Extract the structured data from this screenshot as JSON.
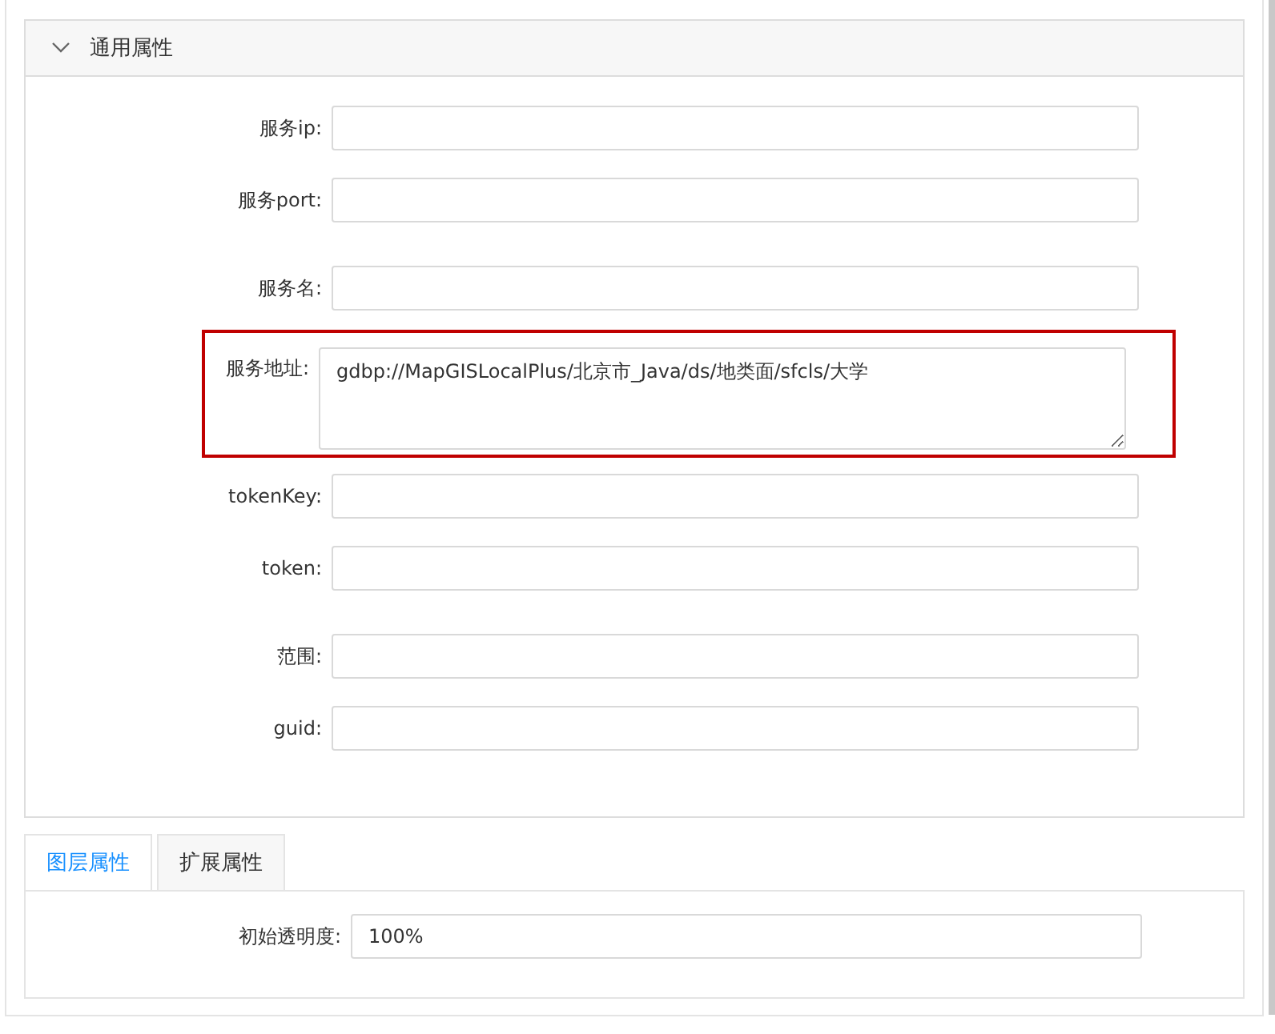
{
  "section": {
    "title": "通用属性",
    "expanded": true,
    "fields": [
      {
        "label": "服务ip:",
        "kind": "input",
        "highlighted": false
      },
      {
        "label": "服务port:",
        "kind": "input",
        "highlighted": false
      },
      {
        "label": "服务名:",
        "kind": "input",
        "highlighted": false
      },
      {
        "label": "服务地址:",
        "kind": "textarea",
        "value": "gdbp://MapGISLocalPlus/北京市_Java/ds/地类面/sfcls/大学",
        "highlighted": true
      },
      {
        "label": "tokenKey:",
        "kind": "input",
        "highlighted": false
      },
      {
        "label": "token:",
        "kind": "input",
        "highlighted": false
      },
      {
        "label": "范围:",
        "kind": "input",
        "highlighted": false
      },
      {
        "label": "guid:",
        "kind": "input",
        "highlighted": false
      }
    ]
  },
  "tabs": [
    {
      "label": "图层属性",
      "selected": true
    },
    {
      "label": "扩展属性",
      "selected": false
    }
  ],
  "layer": {
    "fields": [
      {
        "label": "初始透明度:",
        "value": "100%"
      }
    ]
  }
}
